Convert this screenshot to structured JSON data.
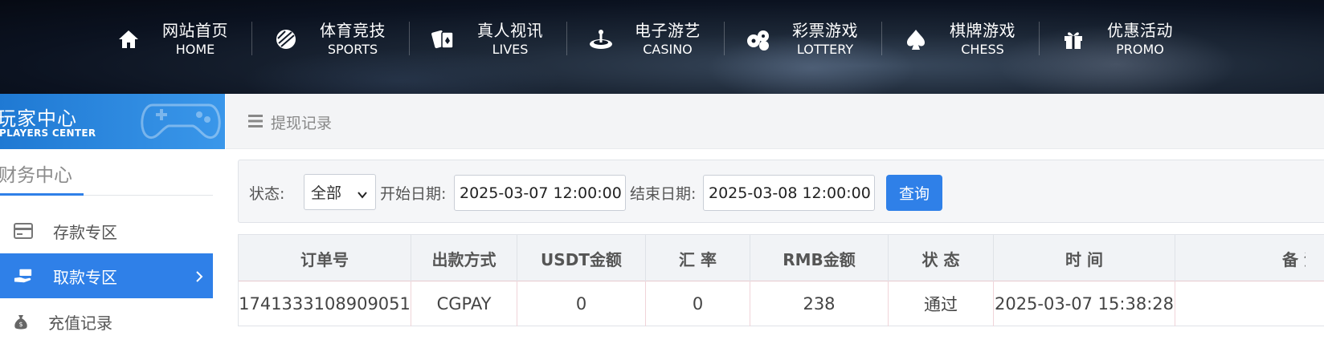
{
  "nav": {
    "items": [
      {
        "cn": "网站首页",
        "en": "HOME",
        "icon": "home-icon"
      },
      {
        "cn": "体育竞技",
        "en": "SPORTS",
        "icon": "ball-icon"
      },
      {
        "cn": "真人视讯",
        "en": "LIVES",
        "icon": "cards-icon"
      },
      {
        "cn": "电子游艺",
        "en": "CASINO",
        "icon": "roulette-icon"
      },
      {
        "cn": "彩票游戏",
        "en": "LOTTERY",
        "icon": "lottery-balls-icon"
      },
      {
        "cn": "棋牌游戏",
        "en": "CHESS",
        "icon": "spade-icon"
      },
      {
        "cn": "优惠活动",
        "en": "PROMO",
        "icon": "gift-icon"
      }
    ]
  },
  "sidebar": {
    "banner_cn": "玩家中心",
    "banner_en": "PLAYERS CENTER",
    "section_title": "财务中心",
    "items": [
      {
        "label": "存款专区",
        "icon": "card-icon",
        "active": false
      },
      {
        "label": "取款专区",
        "icon": "hand-cash-icon",
        "active": true
      },
      {
        "label": "充值记录",
        "icon": "money-bag-icon",
        "active": false
      }
    ]
  },
  "page": {
    "title": "提现记录"
  },
  "filter": {
    "status_label": "状态:",
    "status_value": "全部",
    "start_label": "开始日期:",
    "start_value": "2025-03-07 12:00:00",
    "end_label": "结束日期:",
    "end_value": "2025-03-08 12:00:00",
    "query_button": "查询"
  },
  "table": {
    "headers": [
      "订单号",
      "出款方式",
      "USDT金额",
      "汇 率",
      "RMB金额",
      "状 态",
      "时 间",
      "备 注"
    ],
    "rows": [
      [
        "1741333108909051",
        "CGPAY",
        "0",
        "0",
        "238",
        "通过",
        "2025-03-07 15:38:28",
        ""
      ]
    ]
  },
  "colors": {
    "accent": "#2f80e8",
    "nav_bg": "#0b1220"
  }
}
